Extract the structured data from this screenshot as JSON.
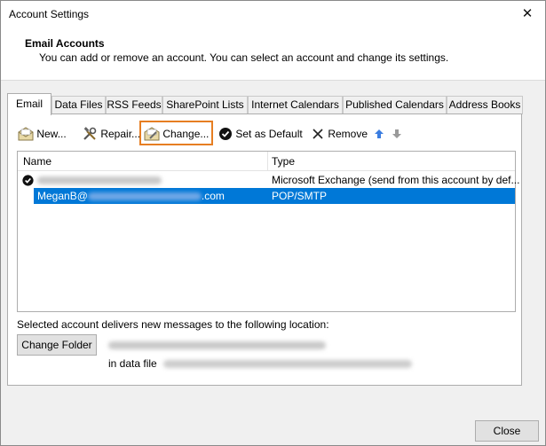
{
  "window": {
    "title": "Account Settings",
    "close_glyph": "✕"
  },
  "header": {
    "title": "Email Accounts",
    "subtitle": "You can add or remove an account. You can select an account and change its settings."
  },
  "tabs": [
    {
      "label": "Email",
      "active": true
    },
    {
      "label": "Data Files"
    },
    {
      "label": "RSS Feeds"
    },
    {
      "label": "SharePoint Lists"
    },
    {
      "label": "Internet Calendars"
    },
    {
      "label": "Published Calendars"
    },
    {
      "label": "Address Books"
    }
  ],
  "toolbar": {
    "new_label": "New...",
    "repair_label": "Repair...",
    "change_label": "Change...",
    "set_default_label": "Set as Default",
    "remove_label": "Remove"
  },
  "accounts_table": {
    "columns": [
      "Name",
      "Type"
    ],
    "rows": [
      {
        "name": "",
        "type": "Microsoft Exchange (send from this account by def...",
        "default": true
      },
      {
        "name_prefix": "MeganB@",
        "name_suffix": ".com",
        "type": "POP/SMTP",
        "selected": true
      }
    ]
  },
  "delivery": {
    "text": "Selected account delivers new messages to the following location:",
    "change_folder_label": "Change Folder",
    "data_file_label": "in data file"
  },
  "footer": {
    "close_label": "Close"
  },
  "colors": {
    "selection": "#0078d7",
    "highlight_border": "#e67e22",
    "tab_border": "#adadad"
  }
}
